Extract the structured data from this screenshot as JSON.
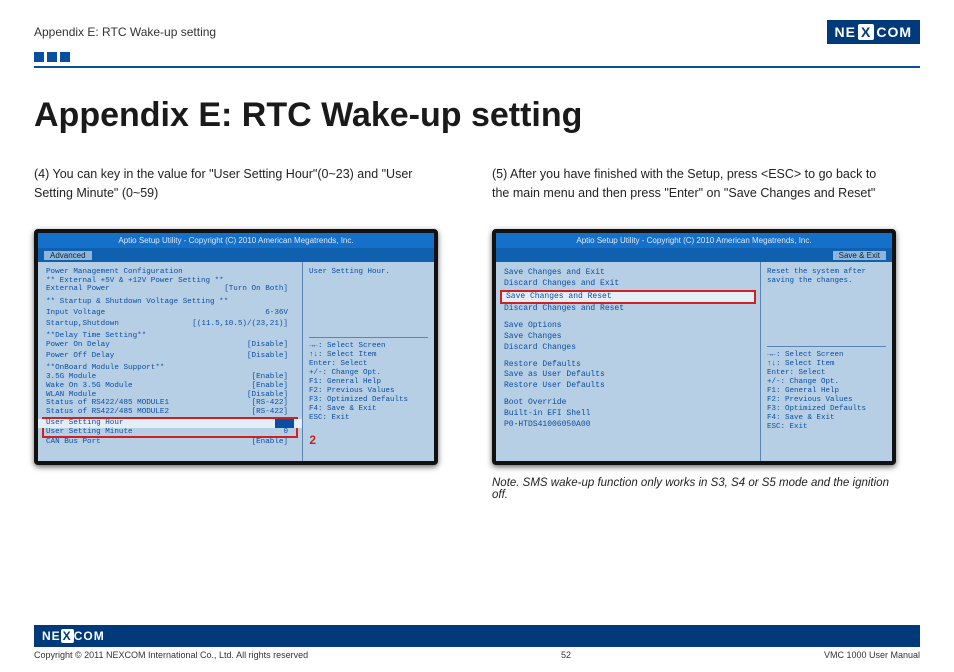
{
  "header": {
    "breadcrumb": "Appendix E: RTC Wake-up setting",
    "logo": "NEXCOM"
  },
  "title": "Appendix E: RTC Wake-up setting",
  "left_col": {
    "para": "(4) You can key in the value for \"User Setting Hour\"(0~23) and \"User Setting Minute\" (0~59)",
    "bios_title": "Aptio Setup Utility - Copyright (C) 2010 American Megatrends, Inc.",
    "tab": "Advanced",
    "left_panel": {
      "h1": "Power Management Configuration",
      "h2": "** External +5V & +12V Power Setting **",
      "ext_power_label": "External Power",
      "ext_power_val": "[Turn On Both]",
      "h3": "** Startup & Shutdown Voltage Setting **",
      "input_v_label": "Input Voltage",
      "input_v_val": "6-36V",
      "startup_label": "Startup,Shutdown",
      "startup_val": "[(11.5,10.5)/(23,21)]",
      "h4": "**Delay Time Setting**",
      "pon_label": "Power On Delay",
      "pon_val": "[Disable]",
      "poff_label": "Power Off Delay",
      "poff_val": "[Disable]",
      "h5": "**OnBoard Module Support**",
      "m35g_label": "3.5G Module",
      "m35g_val": "[Enable]",
      "wake_label": "Wake On 3.5G Module",
      "wake_val": "[Enable]",
      "wlan_label": "WLAN Module",
      "wlan_val": "[Disable]",
      "rs1_label": "Status of RS422/485 MODULE1",
      "rs1_val": "[RS-422]",
      "rs2_label": "Status of RS422/485 MODULE2",
      "rs2_val": "[RS-422]",
      "ush_label": "User Setting Hour",
      "ush_val": "0",
      "usm_label": "User Setting Minute",
      "usm_val": "0",
      "can_label": "CAN Bus Port",
      "can_val": "[Enable]",
      "red_annot": "2"
    },
    "right_panel_top": "User Setting Hour.",
    "help": {
      "l1": "→←: Select Screen",
      "l2": "↑↓: Select Item",
      "l3": "Enter: Select",
      "l4": "+/-: Change Opt.",
      "l5": "F1: General Help",
      "l6": "F2: Previous Values",
      "l7": "F3: Optimized Defaults",
      "l8": "F4: Save & Exit",
      "l9": "ESC: Exit"
    }
  },
  "right_col": {
    "para": "(5) After you have finished with the Setup, press <ESC> to go back to the main menu and then press \"Enter\" on \"Save Changes and Reset\"",
    "bios_title": "Aptio Setup Utility - Copyright (C) 2010 American Megatrends, Inc.",
    "tab": "Save & Exit",
    "left_panel": {
      "i1": "Save Changes and Exit",
      "i2": "Discard Changes and Exit",
      "i3_sel": "Save Changes and Reset",
      "i4": "Discard Changes and Reset",
      "i5": "Save Options",
      "i6": "Save Changes",
      "i7": "Discard Changes",
      "i8": "Restore Defaults",
      "i9": "Save as User Defaults",
      "i10": "Restore User Defaults",
      "i11": "Boot Override",
      "i12": "Built-in EFI Shell",
      "i13": "P0-HTDS41006050A00"
    },
    "right_panel_top": "Reset the system after saving the changes.",
    "help": {
      "l1": "→←: Select Screen",
      "l2": "↑↓: Select Item",
      "l3": "Enter: Select",
      "l4": "+/-: Change Opt.",
      "l5": "F1: General Help",
      "l6": "F2: Previous Values",
      "l7": "F3: Optimized Defaults",
      "l8": "F4: Save & Exit",
      "l9": "ESC: Exit"
    },
    "note": "Note. SMS wake-up function only works in S3, S4 or S5 mode and the ignition off."
  },
  "footer": {
    "logo": "NEXCOM",
    "copyright": "Copyright © 2011 NEXCOM International Co., Ltd. All rights reserved",
    "page": "52",
    "manual": "VMC 1000 User Manual"
  }
}
